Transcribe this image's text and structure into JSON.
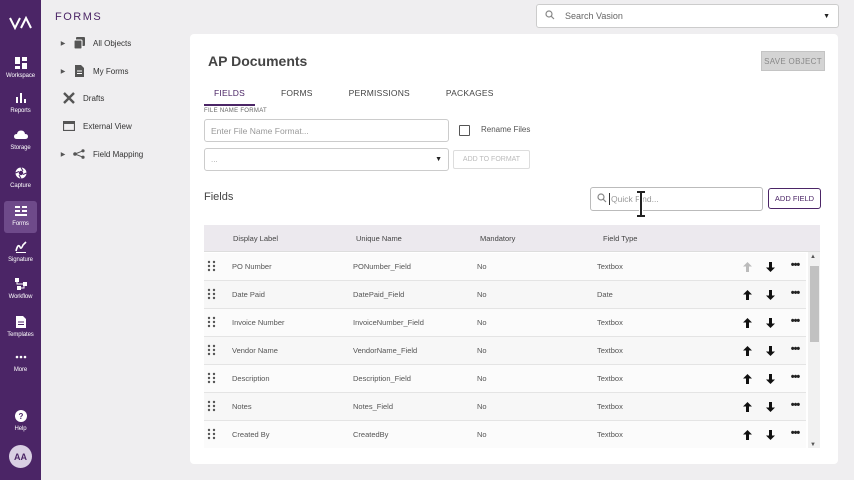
{
  "app": {
    "title": "FORMS"
  },
  "search": {
    "placeholder": "Search Vasion"
  },
  "rail": {
    "items": [
      {
        "label": "Workspace",
        "icon": "grid-icon"
      },
      {
        "label": "Reports",
        "icon": "bar-chart-icon"
      },
      {
        "label": "Storage",
        "icon": "cloud-icon"
      },
      {
        "label": "Capture",
        "icon": "aperture-icon"
      },
      {
        "label": "Forms",
        "icon": "forms-icon"
      },
      {
        "label": "Signature",
        "icon": "signature-icon"
      },
      {
        "label": "Workflow",
        "icon": "workflow-icon"
      },
      {
        "label": "Templates",
        "icon": "document-icon"
      },
      {
        "label": "More",
        "icon": "more-dots-icon"
      },
      {
        "label": "Help",
        "icon": "help-icon"
      }
    ],
    "active": "Forms",
    "avatar": "AA"
  },
  "secnav": {
    "items": [
      {
        "label": "All Objects",
        "icon": "stack-icon",
        "expandable": true
      },
      {
        "label": "My Forms",
        "icon": "file-icon",
        "expandable": true
      },
      {
        "label": "Drafts",
        "icon": "tools-icon",
        "expandable": false
      },
      {
        "label": "External View",
        "icon": "window-icon",
        "expandable": false
      },
      {
        "label": "Field Mapping",
        "icon": "share-icon",
        "expandable": true
      }
    ]
  },
  "main": {
    "title": "AP Documents",
    "save_label": "SAVE OBJECT",
    "tabs": [
      "FIELDS",
      "FORMS",
      "PERMISSIONS",
      "PACKAGES"
    ],
    "active_tab": "FIELDS",
    "file_name_format_label": "FILE NAME FORMAT",
    "file_name_format_placeholder": "Enter File Name Format...",
    "rename_files_label": "Rename Files",
    "rename_files_checked": false,
    "format_select_value": "...",
    "add_to_format_label": "ADD TO FORMAT",
    "fields_title": "Fields",
    "quick_find_placeholder": "Quick Find...",
    "add_field_label": "ADD FIELD"
  },
  "table": {
    "columns": [
      "Display Label",
      "Unique Name",
      "Mandatory",
      "Field Type"
    ],
    "rows": [
      {
        "display": "PO Number",
        "unique": "PONumber_Field",
        "mandatory": "No",
        "type": "Textbox",
        "up_disabled": true
      },
      {
        "display": "Date Paid",
        "unique": "DatePaid_Field",
        "mandatory": "No",
        "type": "Date",
        "up_disabled": false
      },
      {
        "display": "Invoice Number",
        "unique": "InvoiceNumber_Field",
        "mandatory": "No",
        "type": "Textbox",
        "up_disabled": false
      },
      {
        "display": "Vendor Name",
        "unique": "VendorName_Field",
        "mandatory": "No",
        "type": "Textbox",
        "up_disabled": false
      },
      {
        "display": "Description",
        "unique": "Description_Field",
        "mandatory": "No",
        "type": "Textbox",
        "up_disabled": false
      },
      {
        "display": "Notes",
        "unique": "Notes_Field",
        "mandatory": "No",
        "type": "Textbox",
        "up_disabled": false
      },
      {
        "display": "Created By",
        "unique": "CreatedBy",
        "mandatory": "No",
        "type": "Textbox",
        "up_disabled": false
      }
    ]
  },
  "colors": {
    "brand": "#4b2566",
    "rail_active": "#6e4a8a"
  }
}
